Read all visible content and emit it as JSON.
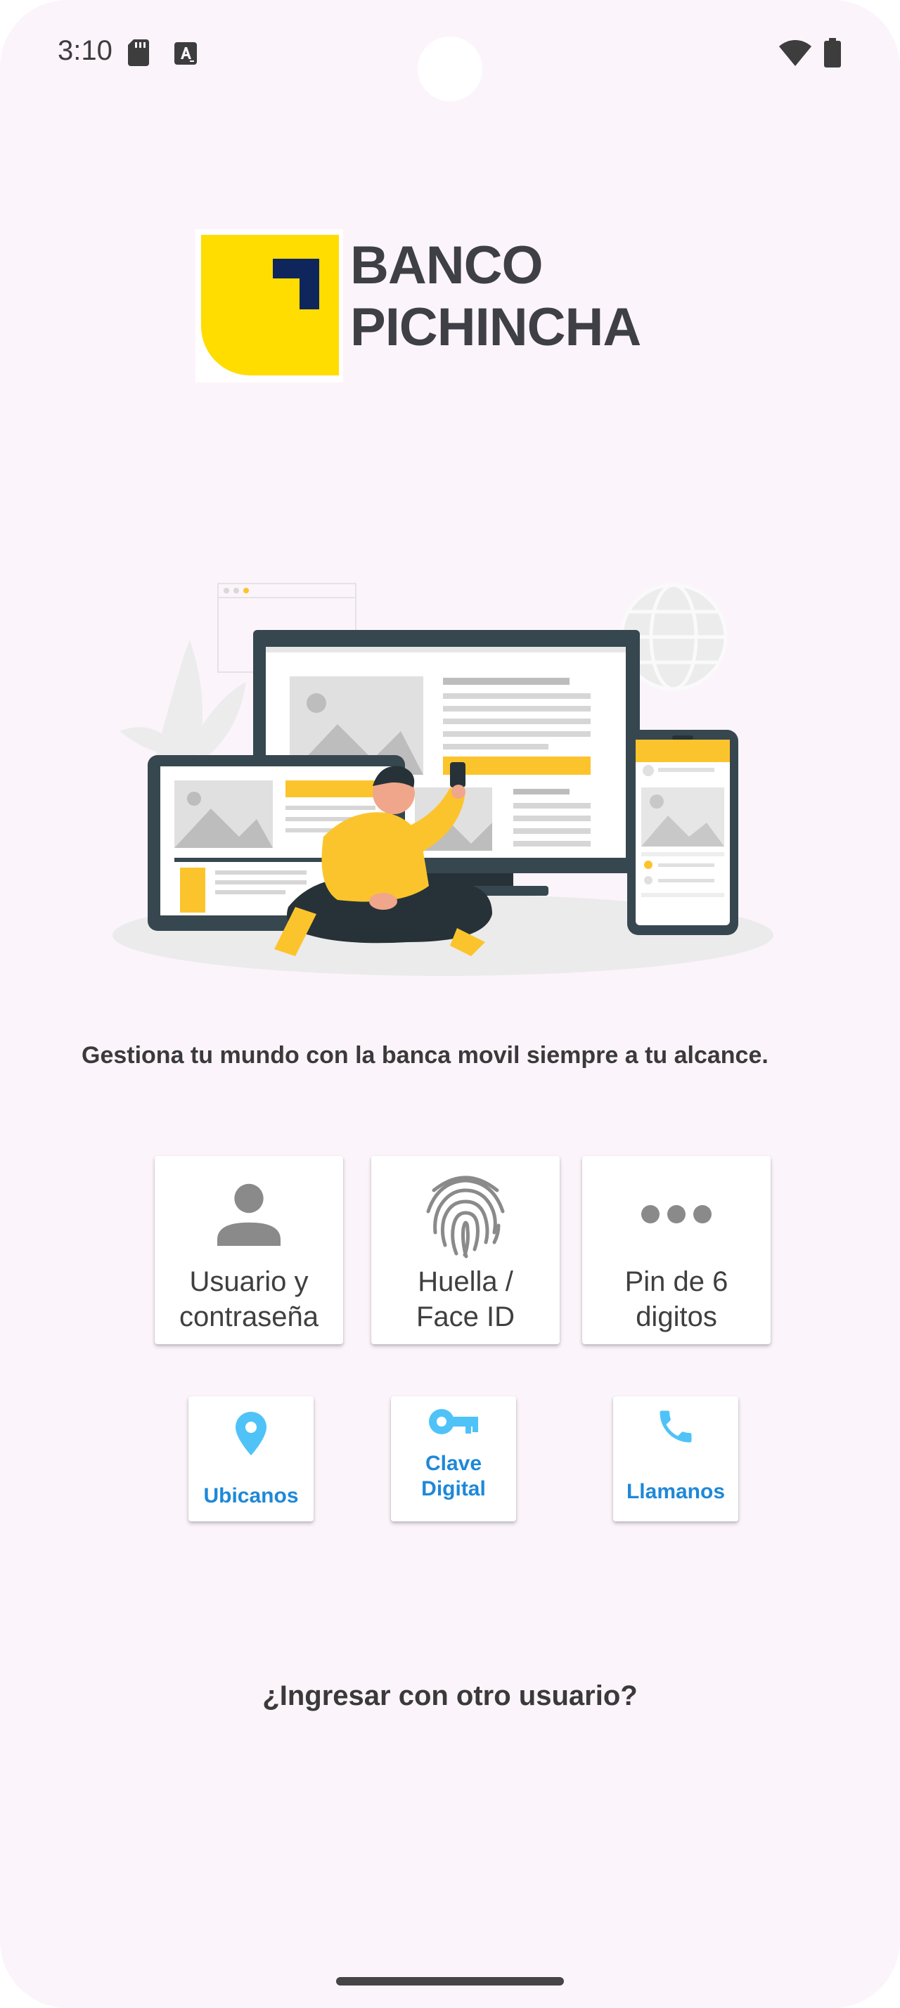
{
  "status_bar": {
    "time": "3:10"
  },
  "logo": {
    "line1": "BANCO",
    "line2": "PICHINCHA",
    "brand_yellow": "#ffdd00",
    "brand_navy": "#0f265c"
  },
  "tagline": "Gestiona tu mundo con la banca movil siempre a tu alcance.",
  "login_options": [
    {
      "icon": "person-icon",
      "label": "Usuario y\ncontraseña"
    },
    {
      "icon": "fingerprint-icon",
      "label": "Huella /\nFace ID"
    },
    {
      "icon": "more-horiz-icon",
      "label": "Pin de 6\ndigitos"
    }
  ],
  "quick_actions": [
    {
      "icon": "location-pin-icon",
      "label": "Ubicanos"
    },
    {
      "icon": "key-icon",
      "label": "Clave\nDigital"
    },
    {
      "icon": "phone-icon",
      "label": "Llamanos"
    }
  ],
  "other_user_link": "¿Ingresar con otro usuario?",
  "colors": {
    "background": "#fcf4fb",
    "accent_blue": "#1e88d8",
    "illustration_yellow": "#fcc42c",
    "text_dark": "#3a3a3a"
  }
}
